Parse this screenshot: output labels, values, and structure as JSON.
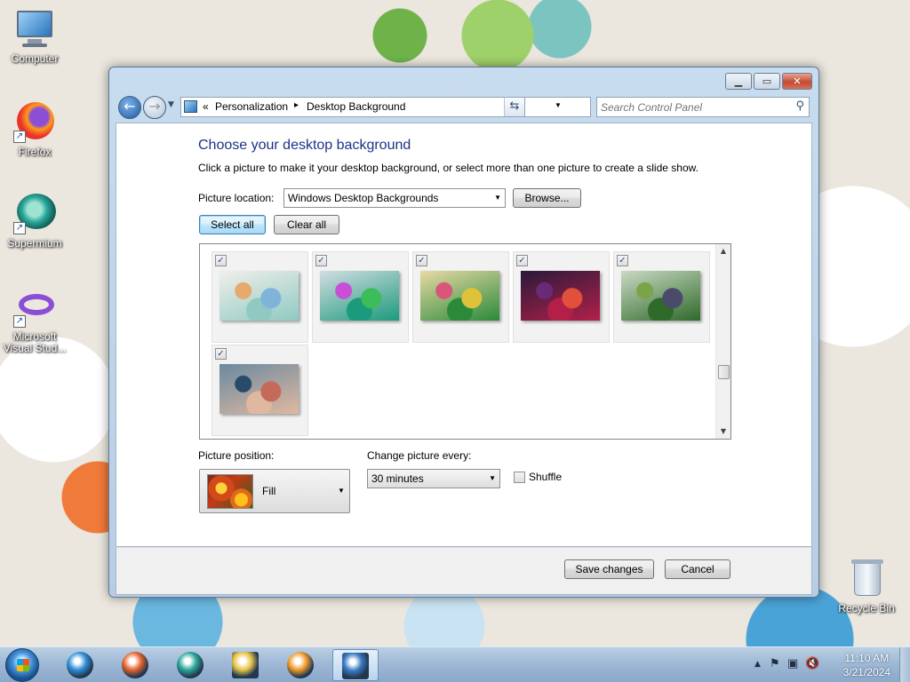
{
  "desktop": {
    "icons": [
      {
        "label": "Computer",
        "icon": "computer-icon"
      },
      {
        "label": "Firefox",
        "icon": "firefox-icon"
      },
      {
        "label": "Supermium",
        "icon": "supermium-icon"
      },
      {
        "label": "Microsoft Visual Stud...",
        "icon": "visual-studio-icon"
      },
      {
        "label": "Recycle Bin",
        "icon": "recycle-bin-icon"
      }
    ]
  },
  "window": {
    "controls": {
      "minimize": "▁",
      "maximize": "▭",
      "close": "✕"
    },
    "breadcrumb": {
      "overflow": "«",
      "items": [
        "Personalization",
        "Desktop Background"
      ],
      "separator": "▸"
    },
    "search": {
      "placeholder": "Search Control Panel"
    },
    "heading": "Choose your desktop background",
    "description": "Click a picture to make it your desktop background, or select more than one picture to create a slide show.",
    "picture_location": {
      "label": "Picture location:",
      "value": "Windows Desktop Backgrounds"
    },
    "browse_label": "Browse...",
    "select_all_label": "Select all",
    "clear_all_label": "Clear all",
    "gallery": {
      "items": [
        {
          "checked": true,
          "colors": [
            "#f1efea",
            "#8fc9c2",
            "#e6a96b",
            "#7fb3d9"
          ]
        },
        {
          "checked": true,
          "colors": [
            "#d3dde2",
            "#1c9a7c",
            "#c84fd6",
            "#3dbd5a"
          ]
        },
        {
          "checked": true,
          "colors": [
            "#e8d9a4",
            "#2a8a3a",
            "#d9557a",
            "#e0c23a"
          ]
        },
        {
          "checked": true,
          "colors": [
            "#2a1a3a",
            "#b2204a",
            "#6a2a7a",
            "#e0503a"
          ]
        },
        {
          "checked": true,
          "colors": [
            "#c9d9c3",
            "#2f6a2a",
            "#7aa34a",
            "#4a4a6a"
          ]
        },
        {
          "checked": true,
          "colors": [
            "#6a8aa0",
            "#e0b8a0",
            "#2a4a6a",
            "#c46a5a"
          ]
        }
      ]
    },
    "picture_position": {
      "label": "Picture position:",
      "value": "Fill"
    },
    "change_every": {
      "label": "Change picture every:",
      "value": "30 minutes"
    },
    "shuffle": {
      "label": "Shuffle",
      "checked": false
    },
    "save_label": "Save changes",
    "cancel_label": "Cancel"
  },
  "taskbar": {
    "items": [
      {
        "name": "internet-explorer",
        "color": "#2f8fd8"
      },
      {
        "name": "firefox",
        "color": "#e8632a"
      },
      {
        "name": "supermium",
        "color": "#2aa79a"
      },
      {
        "name": "file-explorer",
        "color": "#e8c44a"
      },
      {
        "name": "media-player",
        "color": "#f09a2a"
      },
      {
        "name": "control-panel",
        "color": "#3a7ac4",
        "active": true
      }
    ],
    "clock": {
      "time": "11:10 AM",
      "date": "3/21/2024"
    }
  }
}
